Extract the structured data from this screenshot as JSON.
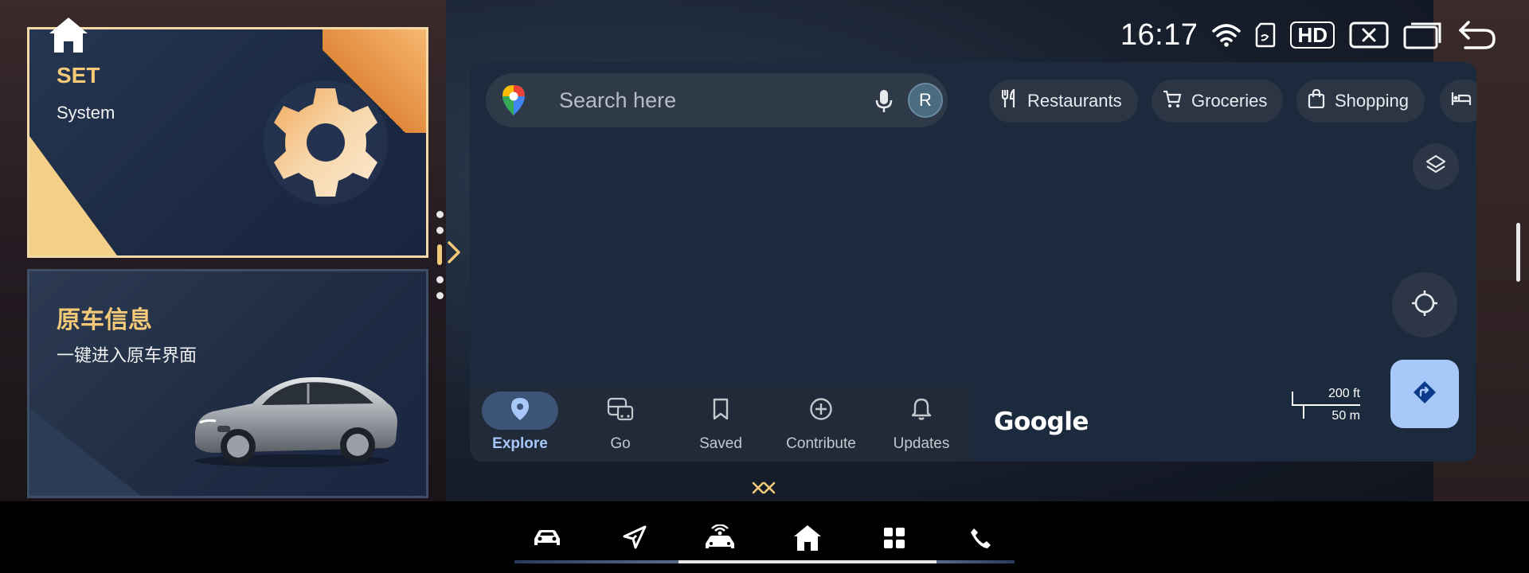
{
  "status_bar": {
    "time": "16:17",
    "hd_label": "HD",
    "icons": [
      "wifi-icon",
      "sd-card-icon",
      "hd-badge",
      "close-window-icon",
      "split-window-icon",
      "back-icon"
    ]
  },
  "cards": {
    "set": {
      "title": "SET",
      "subtitle": "System",
      "icon": "gear-icon"
    },
    "car_info": {
      "title": "原车信息",
      "subtitle": "一键进入原车界面",
      "image": "car-image"
    }
  },
  "map": {
    "search_placeholder": "Search here",
    "avatar_letter": "R",
    "chips": [
      "Restaurants",
      "Groceries",
      "Shopping"
    ],
    "nav": [
      {
        "label": "Explore",
        "icon": "pin-icon",
        "active": true
      },
      {
        "label": "Go",
        "icon": "transit-icon",
        "active": false
      },
      {
        "label": "Saved",
        "icon": "bookmark-icon",
        "active": false
      },
      {
        "label": "Contribute",
        "icon": "plus-circle-icon",
        "active": false
      },
      {
        "label": "Updates",
        "icon": "bell-icon",
        "active": false
      }
    ],
    "logo": "Google",
    "scale_ft": "200 ft",
    "scale_m": "50 m"
  },
  "dock": {
    "items": [
      "car-icon",
      "navigation-icon",
      "car-sensor-icon",
      "home-icon",
      "apps-icon",
      "phone-icon"
    ],
    "active_item": "home-icon"
  },
  "colors": {
    "accent_gold": "#f4c978",
    "map_bg": "#1c2a3d",
    "nav_active": "#a8c8fa"
  }
}
